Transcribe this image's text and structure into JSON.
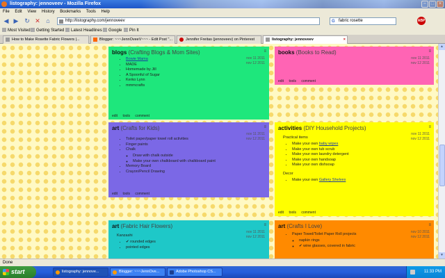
{
  "window": {
    "title": "listography: jennoveev - Mozilla Firefox"
  },
  "menu": [
    "File",
    "Edit",
    "View",
    "History",
    "Bookmarks",
    "Tools",
    "Help"
  ],
  "nav": {
    "url": "http://listography.com/jennoveev",
    "search_value": "fabric rosette"
  },
  "bookmarks": [
    "Most Visited",
    "Getting Started",
    "Latest Headlines",
    "Google",
    "Pin It"
  ],
  "tabs": [
    {
      "label": "How to Make Rosette Fabric Flowers |..."
    },
    {
      "label": "Blogger: ~~~JennOveeV~~~ - Edit Post \"..."
    },
    {
      "label": "Jennifer Freitas (jennoveev) on Pinterest"
    },
    {
      "label": "listography: jennoveev"
    }
  ],
  "cards": {
    "blogs": {
      "title": "blogs",
      "subtitle": "(Crafting Blogs & Mom Sites)",
      "dates": [
        "nov 11 2011",
        "nov 12 2011"
      ],
      "items": [
        "Bowie Mama",
        "MADE",
        "Homemade by Jill",
        "A Spoonful of Sugar",
        "Kerko Lynn",
        "mmmcrafts"
      ],
      "footer": [
        "edit",
        "tools",
        "comment"
      ]
    },
    "books": {
      "title": "books",
      "subtitle": "(Books to Read)",
      "dates": [
        "nov 11 2011",
        "nov 12 2011"
      ],
      "footer": [
        "edit",
        "tools",
        "comment"
      ]
    },
    "art_kids": {
      "title": "art",
      "subtitle": "(Crafts for Kids)",
      "dates": [
        "nov 11 2011",
        "nov 12 2011"
      ],
      "items": [
        "Toilet paper/paper towel roll activities",
        "Finger paints",
        "Chalk",
        "Memory Board",
        "Crayon/Pencil Drawing"
      ],
      "chalk_sub": [
        "Draw with chalk outside",
        "Make your own chalkboard with chalkboard paint"
      ],
      "footer": [
        "edit",
        "tools",
        "comment"
      ]
    },
    "activities": {
      "title": "activities",
      "subtitle": "(DIY Household Projects)",
      "dates": [
        "nov 11 2011",
        "nov 12 2011"
      ],
      "section1": "Practical items",
      "items1_prefix": "Make your own",
      "items1": [
        {
          "text": "baby wipes",
          "link": true
        },
        {
          "text": "tub scrub",
          "link": false
        },
        {
          "text": "laundry detergent",
          "link": false
        },
        {
          "text": "handsoap",
          "link": false
        },
        {
          "text": "dishsoap",
          "link": false
        }
      ],
      "section2": "Decor",
      "items2": [
        {
          "text": "Gallery Shelves",
          "link": true
        }
      ],
      "footer": [
        "edit",
        "tools",
        "comment"
      ]
    },
    "art_hair": {
      "title": "art",
      "subtitle": "(Fabric Hair Flowers)",
      "dates": [
        "nov 11 2011",
        "nov 12 2011"
      ],
      "section": "Kanzashi",
      "items": [
        "✔ rounded edges",
        "pointed edges"
      ]
    },
    "art_love": {
      "title": "art",
      "subtitle": "(Crafts I Love)",
      "dates": [
        "nov 10 2011",
        "nov 12 2011"
      ],
      "items": [
        "Paper Towel/Toilet Paper Roll projects"
      ],
      "sub": [
        "napkin rings",
        "✔ wine glasses, covered in fabric"
      ]
    }
  },
  "status": "Done",
  "taskbar": {
    "start": "start",
    "tasks": [
      "listography: jennove...",
      "Blogger: ~~~JennOve...",
      "Adobe Photoshop CS..."
    ],
    "clock": "11:33 PM"
  },
  "colors": {
    "blogs": "#1ee77c",
    "books": "#ff64b4",
    "art_kids": "#7b68e6",
    "activities": "#ffff00",
    "art_hair": "#1ec8c8",
    "art_love": "#ff8a00"
  }
}
